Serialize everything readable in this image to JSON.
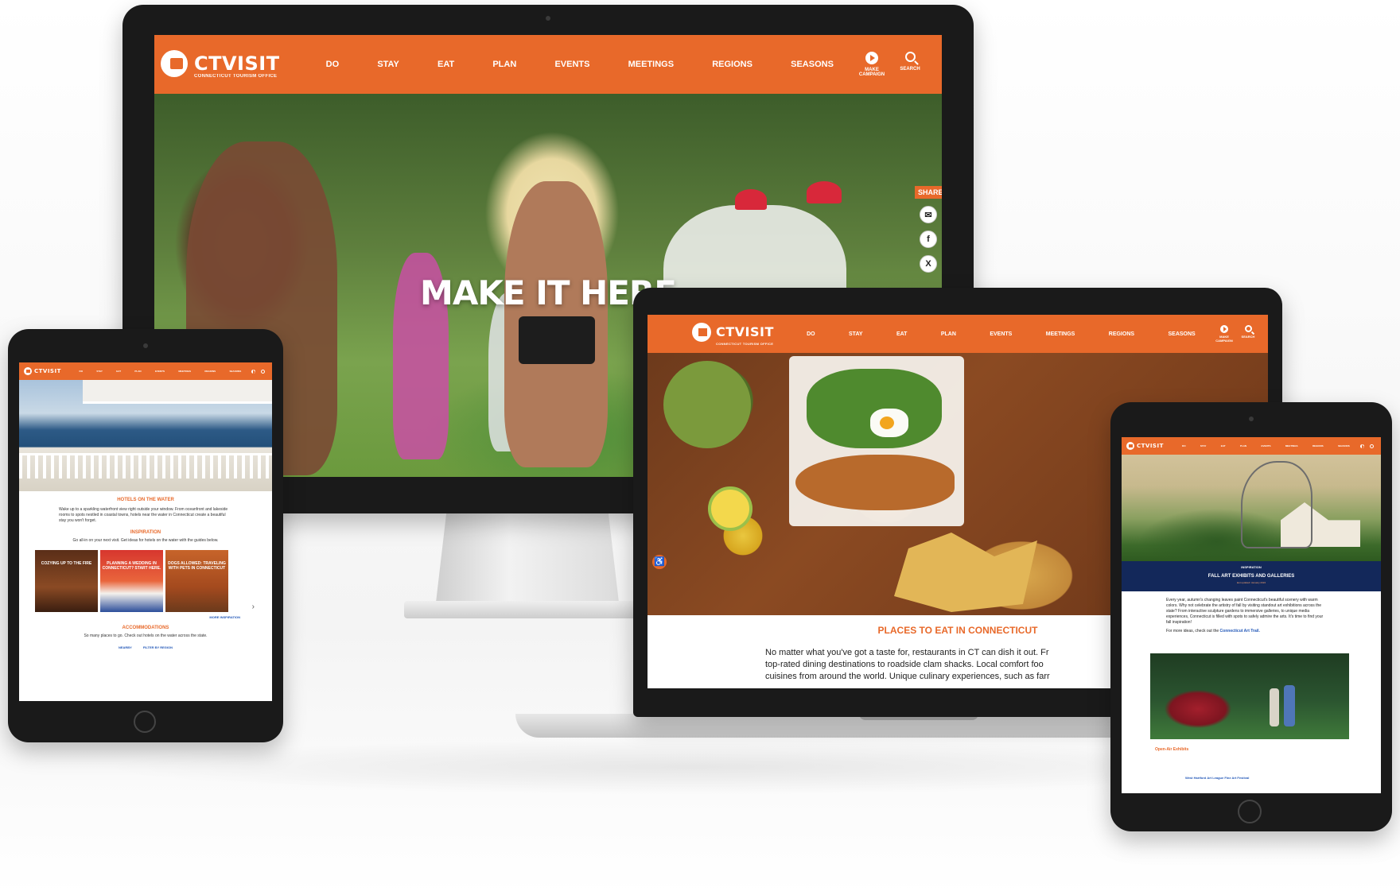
{
  "site": {
    "logo_text": "CTVISIT",
    "logo_sub": "CONNECTICUT TOURISM OFFICE",
    "nav": [
      "DO",
      "STAY",
      "EAT",
      "PLAN",
      "EVENTS",
      "MEETINGS",
      "REGIONS",
      "SEASONS"
    ],
    "tools": {
      "campaign": "MAKE CAMPAIGN",
      "search": "SEARCH"
    },
    "accent": "#e8692a"
  },
  "monitor": {
    "hero_title": "MAKE IT HERE",
    "share_label": "SHARE",
    "share_icons": [
      "mail-icon",
      "facebook-icon",
      "x-icon"
    ],
    "share_glyphs": [
      "✉",
      "f",
      "X"
    ]
  },
  "tablet_left": {
    "heading": "HOTELS ON THE WATER",
    "intro": "Wake up to a sparkling waterfront view right outside your window. From oceanfront and lakeside rooms to spots nestled in coastal towns, hotels near the water in Connecticut create a beautiful stay you won't forget.",
    "inspiration_heading": "INSPIRATION",
    "inspiration_text": "Go all-in on your next visit. Get ideas for hotels on the water with the guides below.",
    "cards": [
      {
        "title": "COZYING UP TO THE FIRE"
      },
      {
        "title": "PLANNING A WEDDING IN CONNECTICUT? START HERE."
      },
      {
        "title": "DOGS ALLOWED: TRAVELING WITH PETS IN CONNECTICUT"
      }
    ],
    "more": "MORE INSPIRATION",
    "accommodations_heading": "ACCOMMODATIONS",
    "accommodations_text": "So many places to go. Check out hotels on the water across the state.",
    "filter_1": "NEARBY",
    "filter_2": "FILTER BY REGION"
  },
  "laptop": {
    "heading": "PLACES TO EAT IN CONNECTICUT",
    "lines": [
      "No matter what you've got a taste for, restaurants in CT can dish it out. Fr",
      "top-rated dining destinations to roadside clam shacks. Local comfort foo",
      "cuisines from around the world. Unique culinary experiences, such as farr"
    ]
  },
  "tablet_right": {
    "kicker": "INSPIRATION",
    "title": "FALL ART EXHIBITS AND GALLERIES",
    "updated": "last updated: January 2024",
    "para": "Every year, autumn's changing leaves paint Connecticut's beautiful scenery with warm colors. Why not celebrate the artistry of fall by visiting standout art exhibitions across the state? From interactive sculpture gardens to immersive galleries, to unique media experiences, Connecticut is filled with spots to safely admire the arts. It's time to find your fall inspiration!",
    "more_prefix": "For more ideas, check out the",
    "more_link": "Connecticut Art Trail.",
    "caption": "Open-Air Exhibits",
    "caption2": "West Hartford Art League Fine Art Festival"
  }
}
